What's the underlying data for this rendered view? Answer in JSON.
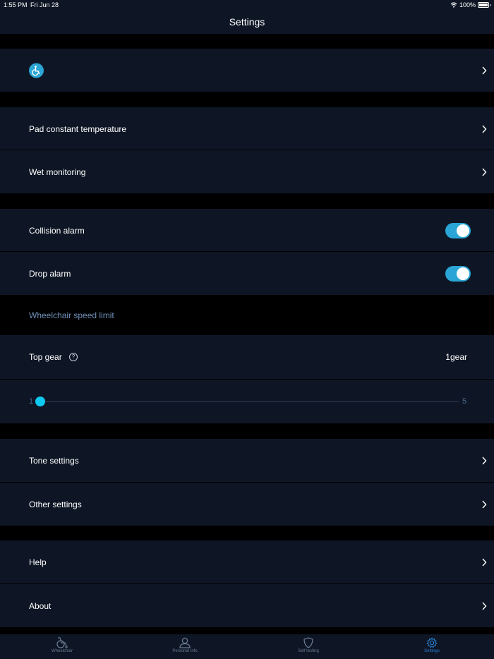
{
  "status_bar": {
    "time": "1:55 PM",
    "date": "Fri Jun 28",
    "battery": "100%"
  },
  "nav": {
    "title": "Settings"
  },
  "wheelchair_row": {
    "icon": "wheelchair-accessible-icon"
  },
  "rows": {
    "pad_temperature": "Pad constant temperature",
    "wet_monitoring": "Wet monitoring",
    "collision_alarm": "Collision alarm",
    "drop_alarm": "Drop alarm",
    "tone_settings": "Tone settings",
    "other_settings": "Other settings",
    "help": "Help",
    "about": "About"
  },
  "toggles": {
    "collision_alarm_on": true,
    "drop_alarm_on": true
  },
  "speed": {
    "section_title": "Wheelchair speed limit",
    "top_gear_label": "Top gear",
    "top_gear_value": "1gear",
    "slider_min": "1",
    "slider_max": "5",
    "slider_value": 1
  },
  "tabs": [
    {
      "label": "Wheelchair",
      "icon": "wheelchair-icon",
      "active": false
    },
    {
      "label": "Personal Info",
      "icon": "person-icon",
      "active": false
    },
    {
      "label": "Self testing",
      "icon": "shield-icon",
      "active": false
    },
    {
      "label": "Settings",
      "icon": "gear-icon",
      "active": true
    }
  ],
  "colors": {
    "background": "#000000",
    "row_background": "#0e1625",
    "accent": "#2aa5d6",
    "slider_thumb": "#0fc9f0",
    "section_header_text": "#6f8fb8",
    "active_tab": "#2a7fd4"
  }
}
